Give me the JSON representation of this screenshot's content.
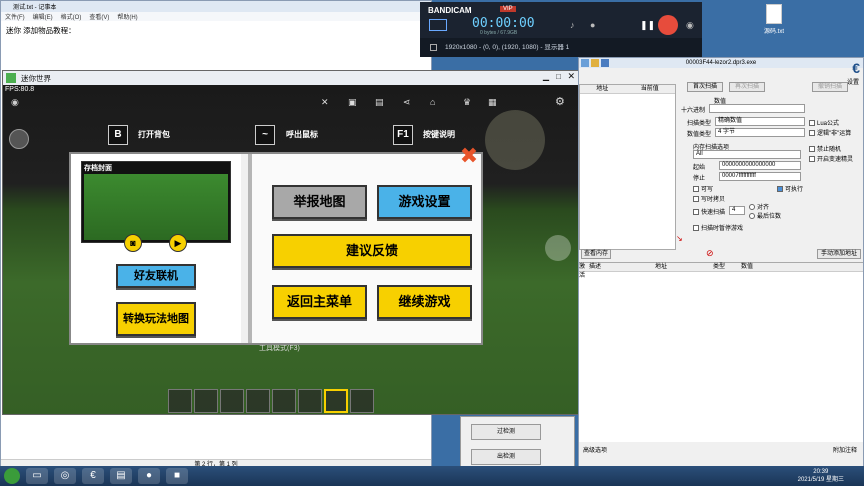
{
  "notepad": {
    "title": "测试.txt - 记事本",
    "menu": [
      "文件(F)",
      "编辑(E)",
      "格式(O)",
      "查看(V)",
      "帮助(H)"
    ],
    "content": "迷你 添加物品教程：",
    "status": "第 2 行，第 1 列"
  },
  "bandicam": {
    "brand": "BANDICAM",
    "tag": "VIP",
    "time": "00:00:00",
    "size": "0 bytes / 67.9GB",
    "resolution": "1920x1080 - (0, 0), (1920, 1080) - 显示器 1"
  },
  "game": {
    "title": "迷你世界",
    "fps": "FPS:80.8",
    "hints": [
      {
        "key": "B",
        "label": "打开背包"
      },
      {
        "key": "~",
        "label": "呼出鼠标"
      },
      {
        "key": "F1",
        "label": "按键说明"
      }
    ],
    "tool_mode": "工具模式(F3)"
  },
  "dialog": {
    "cover_label": "存档封面",
    "btn_friends": "好友联机",
    "btn_switch_map": "转换玩法地图",
    "btn_report": "举报地图",
    "btn_game_settings": "游戏设置",
    "btn_feedback": "建议反馈",
    "btn_back_menu": "返回主菜单",
    "btn_continue": "继续游戏",
    "close": "✖"
  },
  "cheat_engine": {
    "process": "00003F44-lezor2.dpr3.exe",
    "list_headers": [
      "地址",
      "当前值"
    ],
    "first_scan": "首次扫描",
    "next_scan": "再次扫描",
    "undo_scan": "撤销扫描",
    "value_label": "数值",
    "hex_label": "十六进制",
    "scan_type_label": "扫描类型",
    "scan_type_value": "精确数值",
    "value_type_label": "数值类型",
    "value_type_value": "4 字节",
    "memory_options": "内存扫描选项",
    "memory_all": "All",
    "start_label": "起始",
    "start_value": "0000000000000000",
    "stop_label": "停止",
    "stop_value": "00007fffffffffff",
    "writable": "可写",
    "executable": "可执行",
    "copy_on_write": "写时拷贝",
    "fast_scan": "快速扫描",
    "fast_scan_value": "4",
    "align": "对齐",
    "last_digit": "最后位数",
    "pause_game": "扫描时暂停游戏",
    "lua": "Lua公式",
    "not_logic": "逻辑\"非\"运算",
    "disable_random": "禁止随机",
    "speedhack": "开启变速精灵",
    "memory_view": "查看内存",
    "add_address": "手动添加地址",
    "bottom_headers": [
      "激活",
      "描述",
      "地址",
      "类型",
      "数值"
    ],
    "advanced": "高级选项",
    "attach": "附加注释",
    "settings": "设置"
  },
  "mini_panel": {
    "btn1": "过检测",
    "btn2": "出检测"
  },
  "desktop": {
    "file": "源码.txt"
  },
  "taskbar": {
    "time": "20:39",
    "date": "2021/5/19 星期三"
  }
}
